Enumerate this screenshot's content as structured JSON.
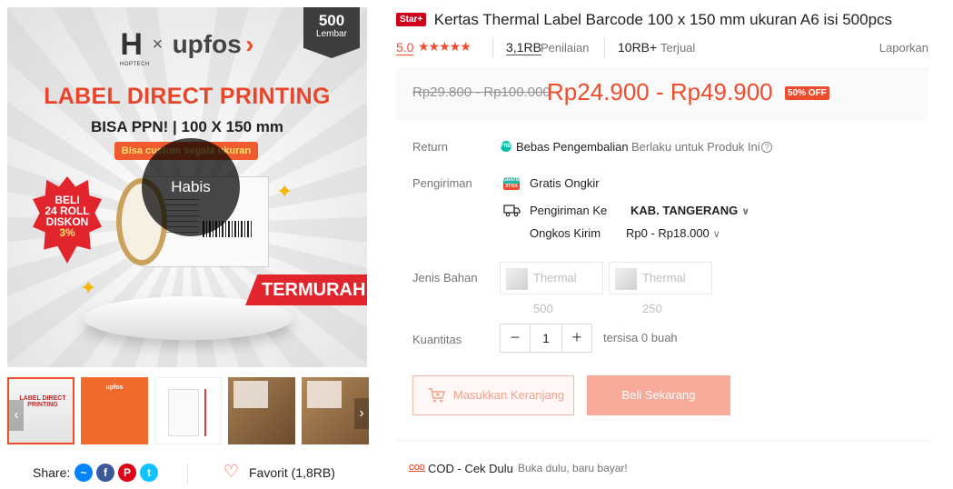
{
  "gallery": {
    "badge": {
      "number": "500",
      "unit": "Lembar"
    },
    "logo": {
      "left": "H",
      "brand_sub": "HOPTECH",
      "times": "×",
      "right": "upfos",
      "chevron": "›"
    },
    "headline": "LABEL DIRECT PRINTING",
    "subline": "BISA PPN! | 100 X 150 mm",
    "custom_tag": "Bisa custom segala ukuran",
    "promo_lines": [
      "BELI",
      "24 ROLL",
      "DISKON",
      "3%"
    ],
    "ribbon": "TERMURAH",
    "overlay": "Habis",
    "thumbnails": [
      {
        "caption": "LABEL DIRECT PRINTING",
        "active": true
      },
      {
        "caption": "upfos",
        "active": false
      },
      {
        "caption": "",
        "active": false
      },
      {
        "caption": "",
        "active": false
      },
      {
        "caption": "",
        "active": false
      }
    ],
    "prev_arrow": "‹",
    "next_arrow": "›"
  },
  "share": {
    "label": "Share:",
    "icons": [
      "messenger-icon",
      "facebook-icon",
      "pinterest-icon",
      "twitter-icon"
    ],
    "icon_glyphs": [
      "~",
      "f",
      "P",
      "t"
    ],
    "icon_colors": [
      "#0084ff",
      "#3b5999",
      "#de0217",
      "#10c2ff"
    ]
  },
  "favorite": {
    "heart": "♡",
    "label": "Favorit (1,8RB)"
  },
  "product": {
    "star_badge": "Star+",
    "title": "Kertas Thermal Label Barcode 100 x 150 mm ukuran A6 isi 500pcs",
    "rating": "5.0",
    "stars": "★★★★★",
    "review_count": "3,1RB",
    "review_label": "Penilaian",
    "sold_count": "10RB+",
    "sold_label": "Terjual",
    "report": "Laporkan",
    "old_price": "Rp29.800 - Rp100.000",
    "price": "Rp24.900 - Rp49.900",
    "discount": "50% OFF"
  },
  "return": {
    "label": "Return",
    "free_icon": "FREE",
    "title": "Bebas Pengembalian",
    "note": "Berlaku untuk Produk Ini",
    "help": "?"
  },
  "shipping": {
    "label": "Pengiriman",
    "free_icon": "GRATIS XTRA",
    "free_label": "Gratis Ongkir",
    "to_label": "Pengiriman Ke",
    "to_value": "KAB. TANGERANG",
    "cost_label": "Ongkos Kirim",
    "cost_value": "Rp0 - Rp18.000",
    "chevron": "∨"
  },
  "variants": {
    "label": "Jenis Bahan",
    "options": [
      "Thermal 500",
      "Thermal 250"
    ]
  },
  "quantity": {
    "label": "Kuantitas",
    "minus": "−",
    "value": "1",
    "plus": "+",
    "stock": "tersisa 0 buah"
  },
  "actions": {
    "add_to_cart": "Masukkan Keranjang",
    "buy_now": "Beli Sekarang"
  },
  "cod": {
    "badge_top": "COD",
    "title": "COD - Cek Dulu",
    "subtitle": "Buka dulu, baru bayar!"
  },
  "colors": {
    "accent": "#ee4d2d",
    "star_badge": "#d0011b",
    "buy_disabled": "#f7a99a"
  }
}
